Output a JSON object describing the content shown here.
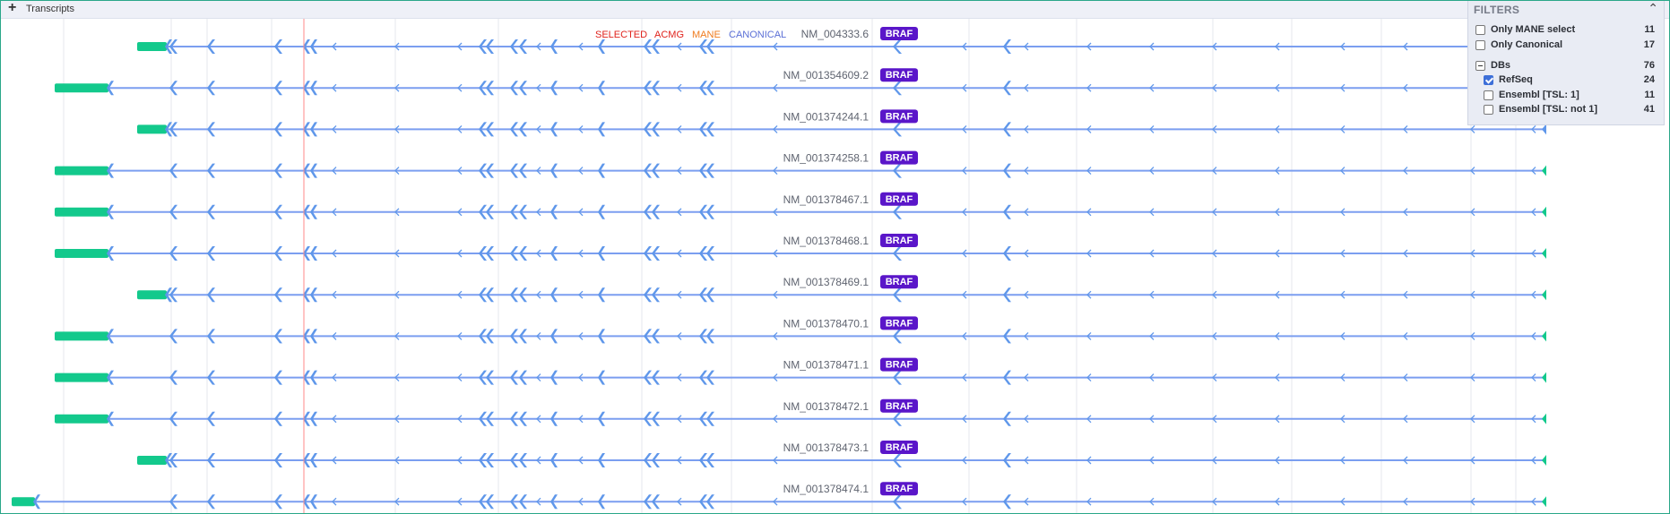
{
  "panel": {
    "title": "Transcripts",
    "expand_icon": "plus-icon"
  },
  "tags": [
    {
      "text": "SELECTED",
      "color": "#e0231c"
    },
    {
      "text": "ACMG",
      "color": "#e0231c"
    },
    {
      "text": "MANE",
      "color": "#ef7b1f"
    },
    {
      "text": "CANONICAL",
      "color": "#5b6fd6"
    }
  ],
  "transcripts": [
    {
      "id": "NM_004333.6",
      "gene": "BRAF"
    },
    {
      "id": "NM_001354609.2",
      "gene": "BRAF"
    },
    {
      "id": "NM_001374244.1",
      "gene": "BRAF"
    },
    {
      "id": "NM_001374258.1",
      "gene": "BRAF"
    },
    {
      "id": "NM_001378467.1",
      "gene": "BRAF"
    },
    {
      "id": "NM_001378468.1",
      "gene": "BRAF"
    },
    {
      "id": "NM_001378469.1",
      "gene": "BRAF"
    },
    {
      "id": "NM_001378470.1",
      "gene": "BRAF"
    },
    {
      "id": "NM_001378471.1",
      "gene": "BRAF"
    },
    {
      "id": "NM_001378472.1",
      "gene": "BRAF"
    },
    {
      "id": "NM_001378473.1",
      "gene": "BRAF"
    },
    {
      "id": "NM_001378474.1",
      "gene": "BRAF"
    }
  ],
  "filters": {
    "title": "FILTERS",
    "collapse_icon": "chevron-up-icon",
    "rows": [
      {
        "label": "Only MANE select",
        "count": "11",
        "state": "unchecked"
      },
      {
        "label": "Only Canonical",
        "count": "17",
        "state": "unchecked"
      },
      {
        "label": "DBs",
        "count": "76",
        "state": "mixed"
      },
      {
        "label": "RefSeq",
        "count": "24",
        "state": "checked"
      },
      {
        "label": "Ensembl [TSL: 1]",
        "count": "11",
        "state": "unchecked"
      },
      {
        "label": "Ensembl [TSL: not 1]",
        "count": "41",
        "state": "unchecked"
      }
    ]
  },
  "colors": {
    "badge": "#5a16c9",
    "exon": "#5f97ea",
    "utr": "#13c98c",
    "line": "#7b9ef0",
    "cursor": "#ff8a8a",
    "border": "#2aa789"
  }
}
